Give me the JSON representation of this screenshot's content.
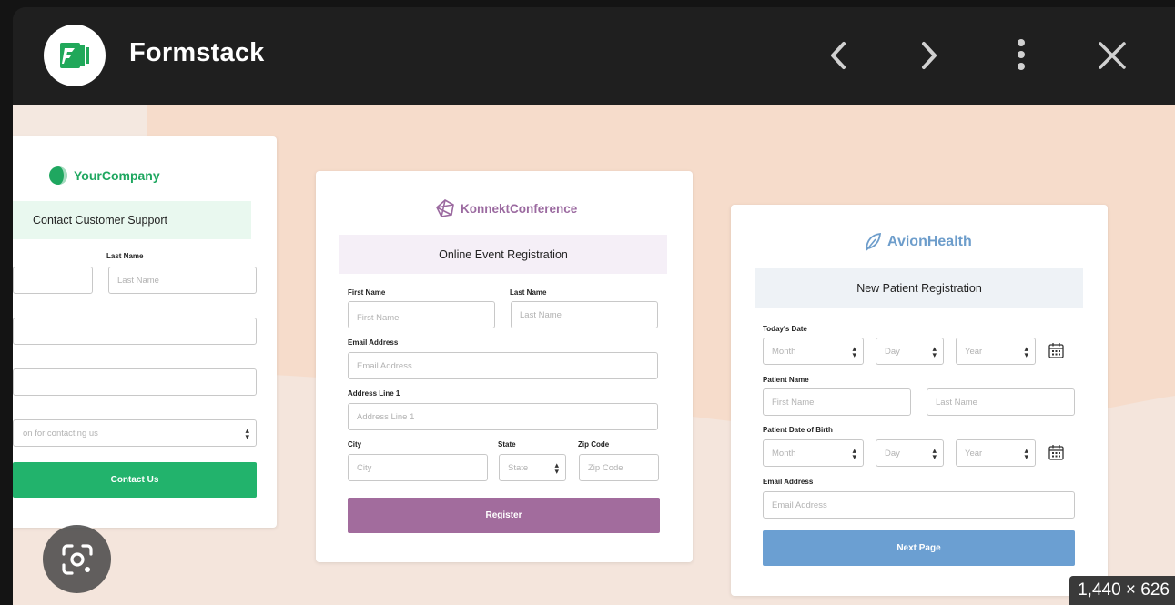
{
  "header": {
    "title": "Formstack",
    "prev_icon": "chevron-left-icon",
    "next_icon": "chevron-right-icon",
    "more_icon": "more-vert-icon",
    "close_icon": "close-icon"
  },
  "colors": {
    "stage_bg": "#f6dccb",
    "your_company": "#1fa760",
    "konnekt": "#9b6aa0",
    "avion": "#6d9dcb"
  },
  "cards": {
    "contact": {
      "logo_text": "YourCompany",
      "title": "Contact Customer Support",
      "last_name_label": "Last Name",
      "last_name_placeholder": "Last Name",
      "reason_placeholder": "on for contacting us",
      "submit_label": "Contact Us"
    },
    "event": {
      "logo_text": "KonnektConference",
      "title": "Online Event Registration",
      "first_name_label": "First Name",
      "first_name_placeholder": "First Name",
      "last_name_label": "Last Name",
      "last_name_placeholder": "Last Name",
      "email_label": "Email Address",
      "email_placeholder": "Email Address",
      "address_label": "Address Line 1",
      "address_placeholder": "Address Line 1",
      "city_label": "City",
      "city_placeholder": "City",
      "state_label": "State",
      "state_placeholder": "State",
      "zip_label": "Zip Code",
      "zip_placeholder": "Zip Code",
      "submit_label": "Register"
    },
    "patient": {
      "logo_text": "AvionHealth",
      "title": "New Patient Registration",
      "todays_date_label": "Today's Date",
      "month_placeholder": "Month",
      "day_placeholder": "Day",
      "year_placeholder": "Year",
      "patient_name_label": "Patient Name",
      "first_name_placeholder": "First Name",
      "last_name_placeholder": "Last Name",
      "dob_label": "Patient Date of Birth",
      "email_label": "Email Address",
      "email_placeholder": "Email Address",
      "submit_label": "Next Page"
    }
  },
  "image_dimensions": "1,440 × 626"
}
